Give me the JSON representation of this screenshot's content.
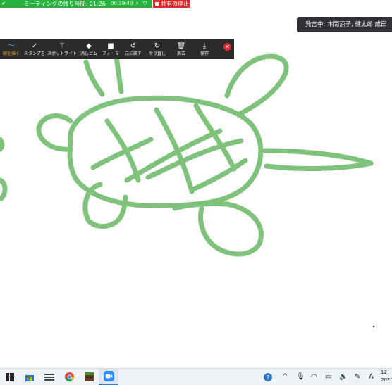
{
  "meeting_bar": {
    "remaining_label": "ミーティングの残り時間: 01:26",
    "elapsed": "00:39:40",
    "stop_share_label": "共有の停止",
    "color": "#27b43e"
  },
  "speaker": {
    "label": "発言中: 本間涼子, 健太郎 成田"
  },
  "toolbar": {
    "tools": [
      {
        "label": "線を描く",
        "icon": "line-icon"
      },
      {
        "label": "スタンプを",
        "icon": "stamp-check-icon"
      },
      {
        "label": "スポットライト",
        "icon": "wand-icon"
      },
      {
        "label": "消しゴム",
        "icon": "eraser-icon"
      },
      {
        "label": "フォーマ",
        "icon": "format-square-icon"
      },
      {
        "label": "元に戻す",
        "icon": "undo-icon"
      },
      {
        "label": "やり直し",
        "icon": "redo-icon"
      },
      {
        "label": "消去",
        "icon": "trash-icon"
      },
      {
        "label": "保存",
        "icon": "save-icon"
      }
    ],
    "active_tool_index": 0,
    "close_icon": "close-icon"
  },
  "drawing": {
    "stroke_color": "#7fc27b",
    "subject": "turtle-drawing"
  },
  "taskbar": {
    "apps": [
      "start-button",
      "store-icon",
      "task-view-icon",
      "chrome-icon",
      "minecraft-icon",
      "zoom-icon"
    ],
    "clock_partial": "12",
    "date_partial": "2020",
    "ime_label": "A"
  }
}
